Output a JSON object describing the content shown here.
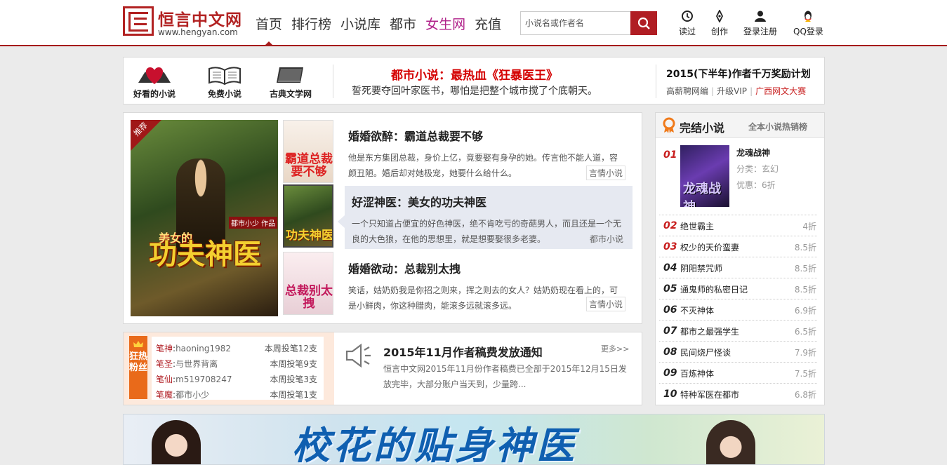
{
  "header": {
    "logo_cn": "恒言中文网",
    "logo_en": "www.hengyan.com",
    "nav": [
      "首页",
      "排行榜",
      "小说库",
      "都市",
      "女生网",
      "充值"
    ],
    "search_placeholder": "小说名或作者名",
    "tools": [
      "读过",
      "创作",
      "登录注册",
      "QQ登录"
    ]
  },
  "banner": {
    "cats": [
      "好看的小说",
      "免费小说",
      "古典文学网"
    ],
    "headline_title": "都市小说：最热血《狂暴医王》",
    "headline_sub": "誓死要夺回叶家医书，哪怕是把整个城市搅了个底朝天。",
    "award_title": "2015(下半年)作者千万奖励计划",
    "award_links": [
      "高薪聘网编",
      "升级VIP",
      "广西网文大赛"
    ]
  },
  "recommend": {
    "badge": "推荐",
    "big_cover": {
      "title": "功夫神医",
      "subtitle": "美女的",
      "author_tag": "都市小少 作品"
    },
    "thumbs": [
      "霸道总裁要不够",
      "功夫神医",
      "总裁别太拽"
    ],
    "items": [
      {
        "title": "婚婚欲醉：霸道总裁要不够",
        "desc": "他是东方集团总裁，身价上亿，竟要娶有身孕的她。传言他不能人道，容颜丑陋。婚后却对她极宠，她要什么给什么。",
        "genre": "言情小说"
      },
      {
        "title": "好涩神医：美女的功夫神医",
        "desc": "一个只知道占便宜的好色神医，绝不肯吃亏的奇葩男人，而且还是一个无良的大色狼，在他的思想里，就是想要娶很多老婆。",
        "genre": "都市小说"
      },
      {
        "title": "婚婚欲动：总裁别太拽",
        "desc": "笑话，姑奶奶我是你招之则来，挥之则去的女人？姑奶奶现在看上的，可是小鲜肉，你这种腊肉，能滚多远就滚多远。",
        "genre": "言情小说"
      }
    ]
  },
  "fans": {
    "badge": "狂热粉丝",
    "list": [
      {
        "level": "笔神",
        "name": "haoning1982",
        "votes": "本周投笔12支"
      },
      {
        "level": "笔圣",
        "name": "与世界背离",
        "votes": "本周投笔9支"
      },
      {
        "level": "笔仙",
        "name": "m519708247",
        "votes": "本周投笔3支"
      },
      {
        "level": "笔魔",
        "name": "都市小少",
        "votes": "本周投笔1支"
      }
    ]
  },
  "notice": {
    "title": "2015年11月作者稿费发放通知",
    "more": "更多>>",
    "desc": "恒言中文网2015年11月份作者稿费已全部于2015年12月15日发放完毕，大部分账户当天到，少量跨..."
  },
  "ranking": {
    "title": "完结小说",
    "subtitle": "全本小说热销榜",
    "first": {
      "rank": "01",
      "name": "龙魂战神",
      "category": "分类：玄幻",
      "discount": "优惠：6折",
      "cover_text": "龙魂战神"
    },
    "items": [
      {
        "rank": "02",
        "name": "绝世霸主",
        "discount": "4折"
      },
      {
        "rank": "03",
        "name": "权少的天价蛮妻",
        "discount": "8.5折"
      },
      {
        "rank": "04",
        "name": "阴阳禁咒师",
        "discount": "8.5折"
      },
      {
        "rank": "05",
        "name": "通鬼师的私密日记",
        "discount": "8.5折"
      },
      {
        "rank": "06",
        "name": "不灭神体",
        "discount": "6.9折"
      },
      {
        "rank": "07",
        "name": "都市之最强学生",
        "discount": "6.5折"
      },
      {
        "rank": "08",
        "name": "民间烧尸怪谈",
        "discount": "7.9折"
      },
      {
        "rank": "09",
        "name": "百炼神体",
        "discount": "7.5折"
      },
      {
        "rank": "10",
        "name": "特种军医在都市",
        "discount": "6.8折"
      }
    ]
  },
  "ad": {
    "text": "校花的贴身神医"
  }
}
